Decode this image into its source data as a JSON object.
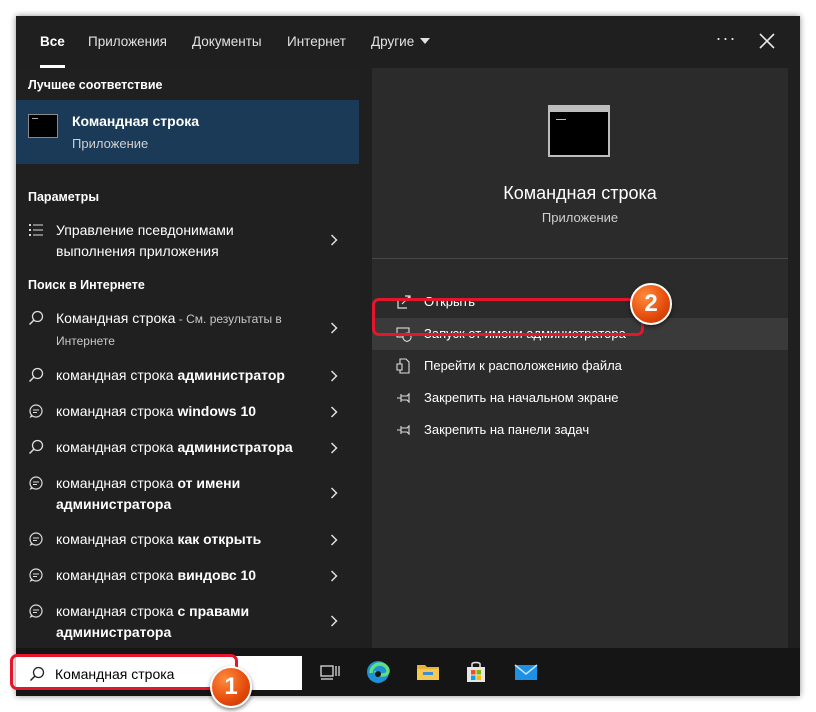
{
  "tabs": [
    {
      "label": "Все",
      "active": true
    },
    {
      "label": "Приложения"
    },
    {
      "label": "Документы"
    },
    {
      "label": "Интернет"
    },
    {
      "label": "Другие"
    }
  ],
  "more_label": "···",
  "left": {
    "best_match_header": "Лучшее соответствие",
    "best_match": {
      "title": "Командная строка",
      "subtitle": "Приложение"
    },
    "settings_header": "Параметры",
    "settings_item": {
      "line1": "Управление псевдонимами",
      "line2": "выполнения приложения"
    },
    "web_header": "Поиск в Интернете",
    "web_items": [
      {
        "plain": "Командная строка",
        "bold": "",
        "suffix": " - См. результаты в",
        "line2": "Интернете",
        "icon": "search-icon"
      },
      {
        "plain": "командная строка ",
        "bold": "администратор",
        "icon": "search-icon"
      },
      {
        "plain": "командная строка ",
        "bold": "windows 10",
        "icon": "chat-search-icon"
      },
      {
        "plain": "командная строка ",
        "bold": "администратора",
        "icon": "search-icon"
      },
      {
        "plain": "командная строка ",
        "bold": "от имени",
        "line2_bold": "администратора",
        "icon": "chat-search-icon"
      },
      {
        "plain": "командная строка ",
        "bold": "как открыть",
        "icon": "chat-search-icon"
      },
      {
        "plain": "командная строка ",
        "bold": "виндовс 10",
        "icon": "chat-search-icon"
      },
      {
        "plain": "командная строка ",
        "bold": "с правами",
        "line2_bold": "администратора",
        "icon": "chat-search-icon"
      }
    ]
  },
  "right": {
    "title": "Командная строка",
    "subtitle": "Приложение",
    "actions": [
      {
        "label": "Открыть",
        "icon": "open-icon"
      },
      {
        "label": "Запуск от имени администратора",
        "icon": "shield-icon",
        "highlighted": true
      },
      {
        "label": "Перейти к расположению файла",
        "icon": "file-location-icon"
      },
      {
        "label": "Закрепить на начальном экране",
        "icon": "pin-icon"
      },
      {
        "label": "Закрепить на панели задач",
        "icon": "pin-icon"
      }
    ]
  },
  "search": {
    "value": "Командная строка"
  },
  "taskbar_icons": [
    "task-view-icon",
    "edge-icon",
    "file-explorer-icon",
    "store-icon",
    "mail-icon"
  ],
  "annotations": {
    "badge1": "1",
    "badge2": "2"
  },
  "colors": {
    "accent_selected": "#1a3a57",
    "annotation_red": "#e3162b",
    "badge_orange": "#e44a0a"
  }
}
